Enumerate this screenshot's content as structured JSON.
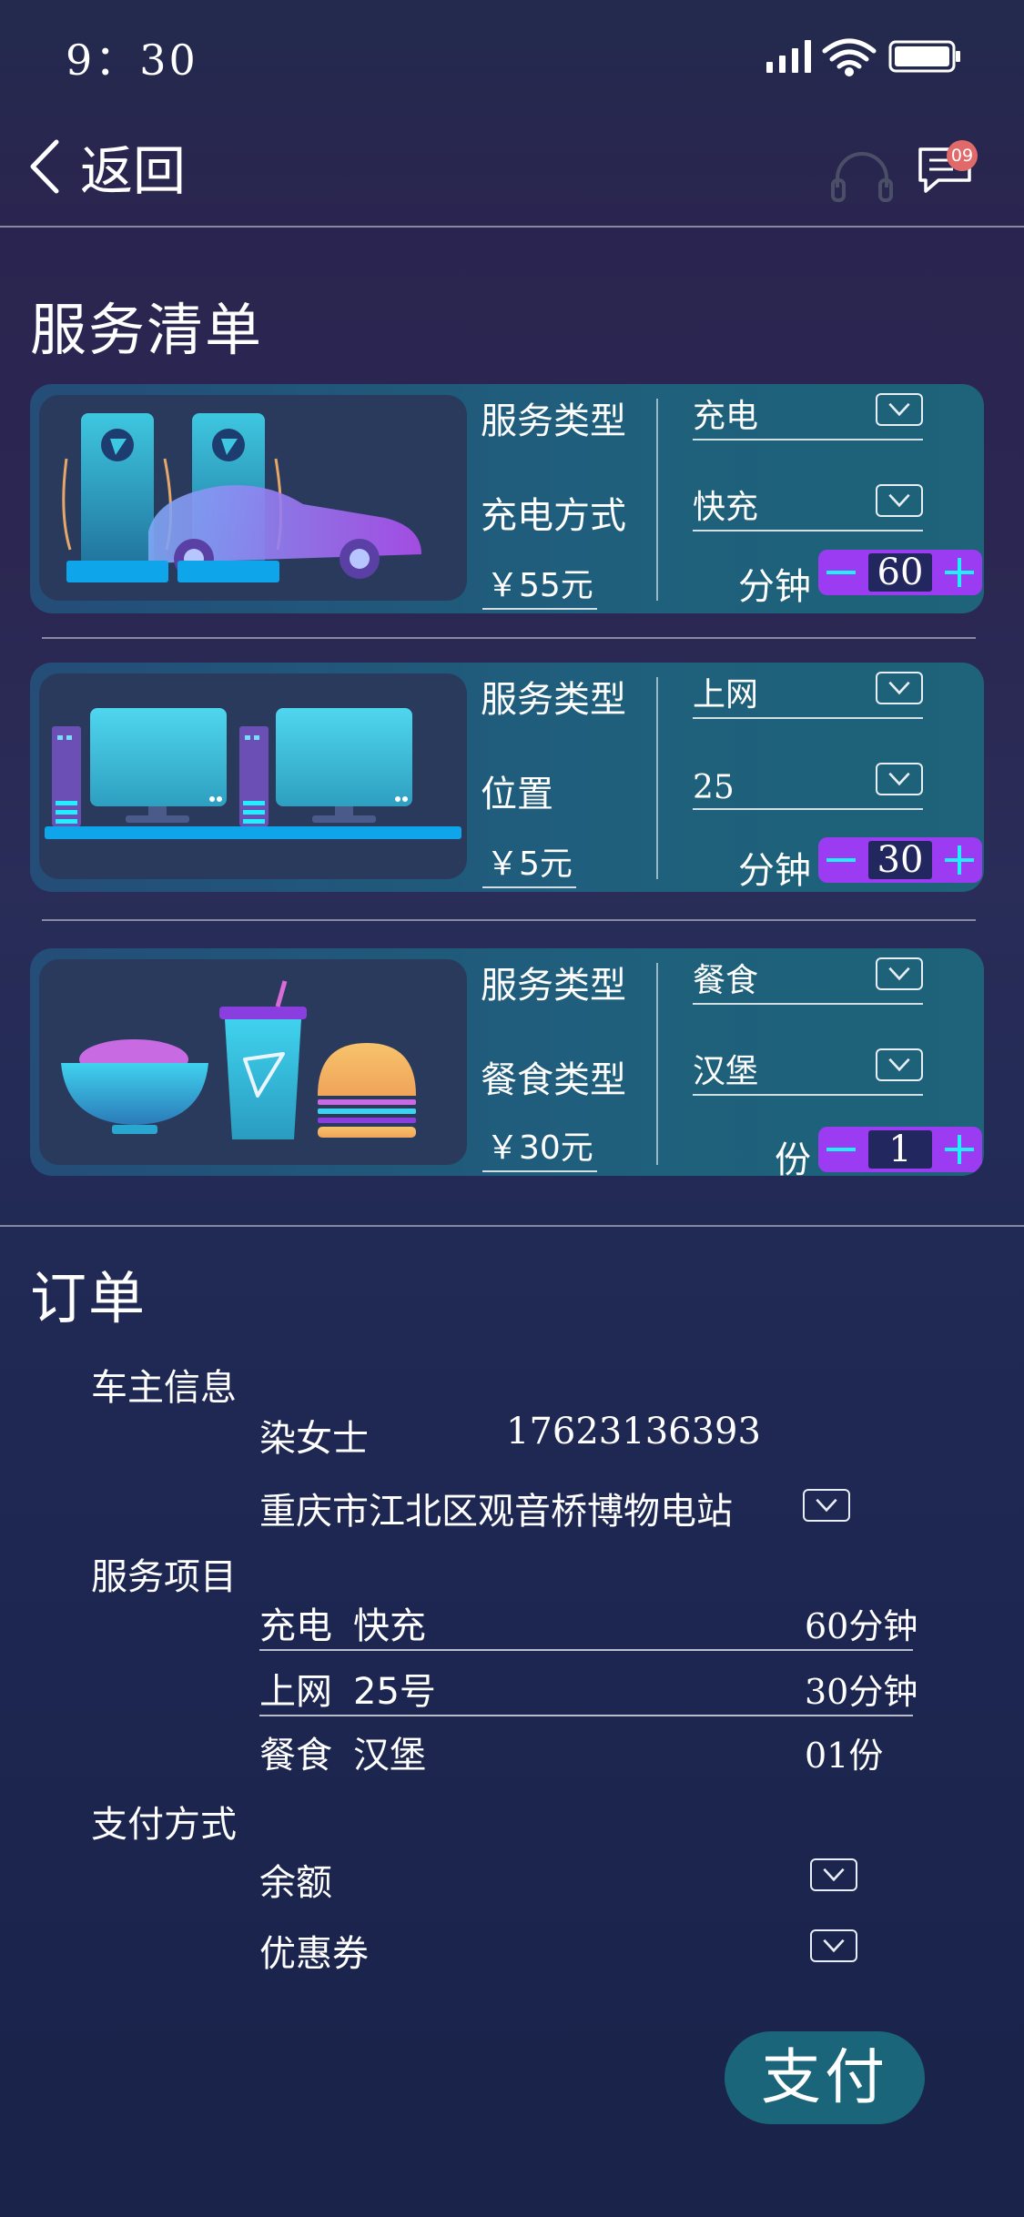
{
  "status_bar": {
    "time": "9：30"
  },
  "header": {
    "back_label": "返回",
    "notification_badge": "09"
  },
  "service_list": {
    "title": "服务清单",
    "cards": [
      {
        "image": "charging-station-illustration",
        "field1_label": "服务类型",
        "field1_value": "充电",
        "field2_label": "充电方式",
        "field2_value": "快充",
        "price": "￥55元",
        "unit": "分钟",
        "quantity": "60"
      },
      {
        "image": "internet-cafe-illustration",
        "field1_label": "服务类型",
        "field1_value": "上网",
        "field2_label": "位置",
        "field2_value": "25",
        "price": "￥5元",
        "unit": "分钟",
        "quantity": "30"
      },
      {
        "image": "food-illustration",
        "field1_label": "服务类型",
        "field1_value": "餐食",
        "field2_label": "餐食类型",
        "field2_value": "汉堡",
        "price": "￥30元",
        "unit": "份",
        "quantity": "1"
      }
    ]
  },
  "order": {
    "title": "订单",
    "owner_label": "车主信息",
    "owner_name": "染女士",
    "owner_phone": "17623136393",
    "owner_address": "重庆市江北区观音桥博物电站",
    "items_label": "服务项目",
    "items": [
      {
        "name": "充电",
        "detail": "快充",
        "amount": "60分钟"
      },
      {
        "name": "上网",
        "detail": "25号",
        "amount": "30分钟"
      },
      {
        "name": "餐食",
        "detail": "汉堡",
        "amount": "01份"
      }
    ],
    "payment_label": "支付方式",
    "payment_options": [
      "余额",
      "优惠券"
    ],
    "pay_button": "支付"
  },
  "colors": {
    "accent": "#9b3cf2",
    "cyan": "#1ef0ff",
    "card": "#1f5f7c",
    "pay": "#1a6579"
  },
  "icons": [
    "back-chevron-icon",
    "headset-icon",
    "message-icon",
    "chevron-down-icon",
    "minus-icon",
    "plus-icon"
  ]
}
